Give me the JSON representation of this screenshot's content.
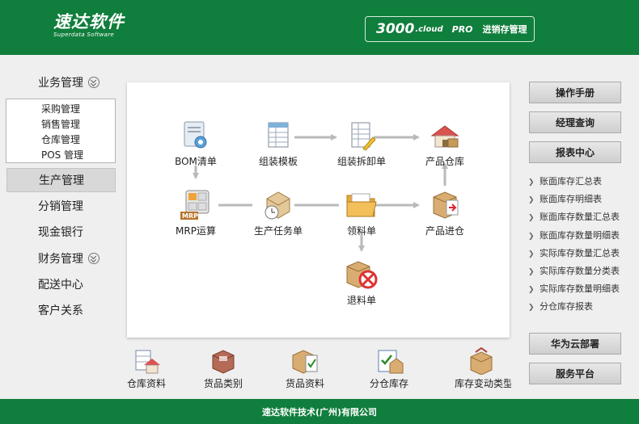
{
  "header": {
    "logo_main": "速达软件",
    "logo_sub": "Superdata Software",
    "product_version": "3000",
    "product_cloud": ".cloud",
    "product_edition": "PRO",
    "product_name": "进销存管理"
  },
  "sidebar": {
    "business": "业务管理",
    "sub_items": [
      "采购管理",
      "销售管理",
      "仓库管理",
      "POS 管理"
    ],
    "production": "生产管理",
    "distribution": "分销管理",
    "cash_bank": "现金银行",
    "finance": "财务管理",
    "delivery": "配送中心",
    "customer": "客户关系"
  },
  "flow": {
    "bom": "BOM清单",
    "assembly_template": "组装模板",
    "assembly_order": "组装拆卸单",
    "product_warehouse": "产品仓库",
    "mrp": "MRP运算",
    "production_task": "生产任务单",
    "material_requisition": "领料单",
    "product_inbound": "产品进仓",
    "material_return": "退料单"
  },
  "quick": {
    "warehouse_info": "仓库资料",
    "goods_category": "货品类别",
    "goods_info": "货品资料",
    "branch_stock": "分仓库存",
    "stock_change": "库存变动类型"
  },
  "right": {
    "manual": "操作手册",
    "manager_query": "经理查询",
    "report_center": "报表中心",
    "reports": [
      "账面库存汇总表",
      "账面库存明细表",
      "账面库存数量汇总表",
      "账面库存数量明细表",
      "实际库存数量汇总表",
      "实际库存数量分类表",
      "实际库存数量明细表",
      "分仓库存报表"
    ],
    "huawei": "华为云部署",
    "service": "服务平台"
  },
  "footer": {
    "company": "速达软件技术(广州)有限公司"
  },
  "colors": {
    "brand_green": "#107e3c",
    "page_bg": "#efefef",
    "arrow_gray": "#b9b9b9"
  }
}
